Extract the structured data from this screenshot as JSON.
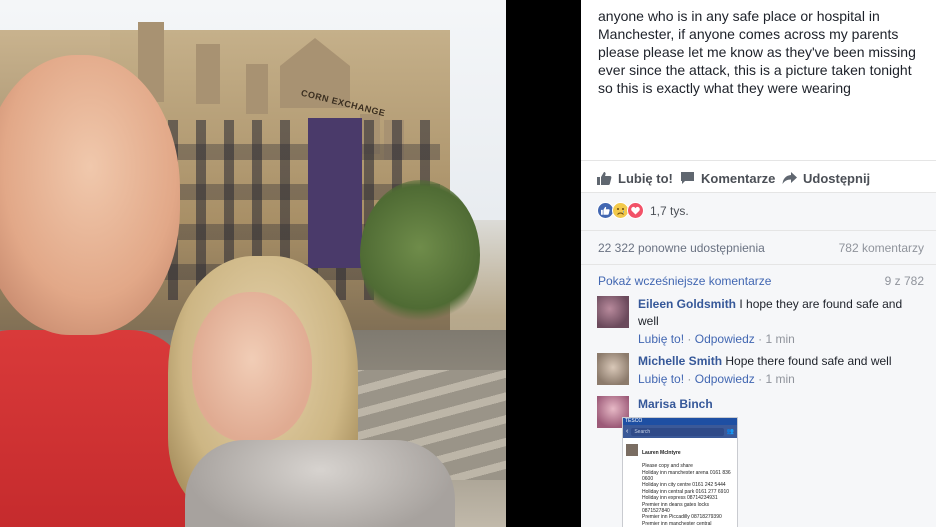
{
  "post": {
    "text": "anyone who is in any safe place or hospital in Manchester, if anyone comes across my parents please please let me know as they've been missing ever since the attack, this is a picture taken tonight so this is exactly what they were wearing"
  },
  "photo": {
    "building_sign": "CORN EXCHANGE"
  },
  "actions": {
    "like_label": "Lubię to!",
    "comment_label": "Komentarze",
    "share_label": "Udostępnij"
  },
  "reactions": {
    "icons": [
      "like-reaction-icon",
      "sad-reaction-icon",
      "love-reaction-icon"
    ],
    "count": "1,7 tys."
  },
  "stats": {
    "shares": "22 322 ponowne udostępnienia",
    "comments": "782 komentarzy"
  },
  "comments_section": {
    "more_label": "Pokaż wcześniejsze komentarze",
    "pager": "9 z 782",
    "items": [
      {
        "author": "Eileen Goldsmith",
        "text": "I hope they are found safe and well",
        "like": "Lubię to!",
        "reply": "Odpowiedz",
        "sep": "·",
        "time": "1 min"
      },
      {
        "author": "Michelle Smith",
        "text": "Hope there found safe and well",
        "like": "Lubię to!",
        "reply": "Odpowiedz",
        "sep": "·",
        "time": "1 min"
      },
      {
        "author": "Marisa Binch",
        "text": ""
      }
    ],
    "screenshot": {
      "status": "TESCO",
      "search": "Search",
      "author": "Lauren McIntyre",
      "lines": "Please copy and share\nHoliday inn manchester arena 0161 836 0600\nHoliday inn city centre 0161 242 5444\nHoliday inn central park 0161 277 6910\nHoliday inn express 08714234931\nPremier inn deans gates locks 0871527840\nPremier inn Piccadilly 08718279390\nPremier inn manchester central"
    }
  },
  "colors": {
    "link": "#365899",
    "like_blue": "#4267b2",
    "sad_yellow": "#f2c94c",
    "love_red": "#f25268",
    "text": "#1d2129",
    "muted": "#90949c"
  }
}
